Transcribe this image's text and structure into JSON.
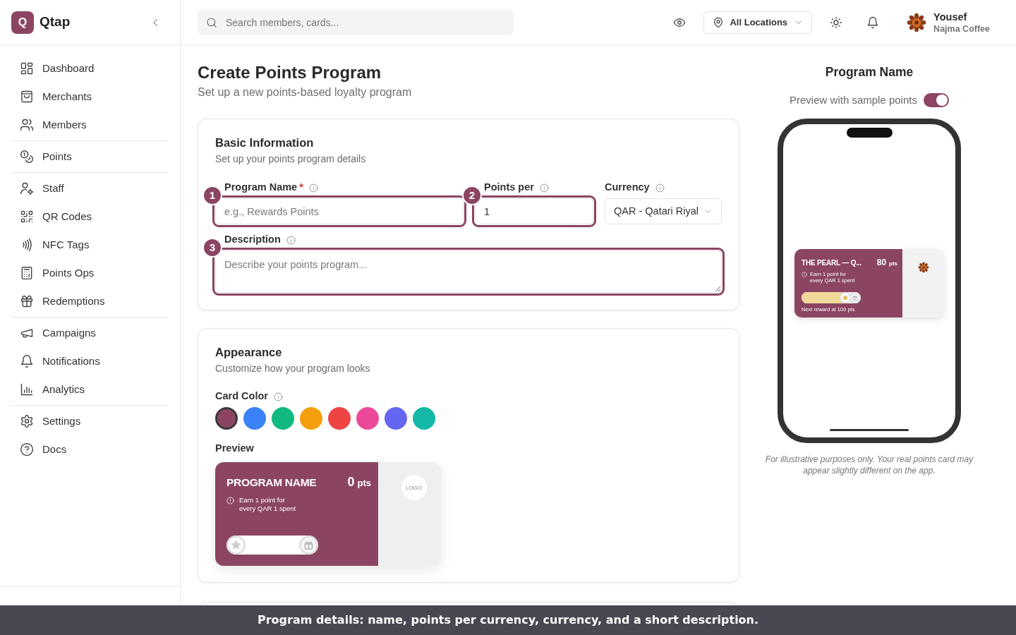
{
  "sidebar": {
    "brand": {
      "logo_letter": "Q",
      "name": "Qtap"
    },
    "nav_groups": [
      {
        "items": [
          {
            "label": "Dashboard",
            "selected": false
          },
          {
            "label": "Merchants",
            "selected": false
          },
          {
            "label": "Members",
            "selected": false
          }
        ]
      },
      {
        "items": [
          {
            "label": "Points",
            "selected": false
          }
        ]
      },
      {
        "items": [
          {
            "label": "Staff",
            "selected": false
          },
          {
            "label": "QR Codes",
            "selected": false
          },
          {
            "label": "NFC Tags",
            "selected": false
          },
          {
            "label": "Points Ops",
            "selected": false
          },
          {
            "label": "Redemptions",
            "selected": false
          }
        ]
      },
      {
        "items": [
          {
            "label": "Campaigns",
            "selected": false
          },
          {
            "label": "Notifications",
            "selected": false
          },
          {
            "label": "Analytics",
            "selected": false
          }
        ]
      },
      {
        "items": [
          {
            "label": "Settings",
            "selected": false
          },
          {
            "label": "Docs",
            "selected": false
          }
        ]
      }
    ]
  },
  "topbar": {
    "search": {
      "placeholder": "Search members, cards..."
    },
    "location": "All Locations",
    "user": {
      "name": "Yousef",
      "business": "Najma Coffee"
    }
  },
  "page": {
    "title": "Create Points Program",
    "subtitle": "Set up a new points-based loyalty program"
  },
  "basic_information": {
    "title": "Basic Information",
    "subtitle": "Set up your points program details",
    "fields": [
      {
        "kind": "text",
        "label": "Program Name",
        "required_mark": "*",
        "placeholder": "e.g., Rewards Points",
        "callout": "1"
      },
      {
        "kind": "text",
        "label": "Points per",
        "value": "1",
        "callout": "2"
      },
      {
        "kind": "select",
        "label": "Currency",
        "value": "QAR - Qatari Riyal"
      },
      {
        "kind": "textarea",
        "label": "Description",
        "placeholder": "Describe your points program...",
        "callout": "3"
      }
    ]
  },
  "appearance": {
    "title": "Appearance",
    "subtitle": "Customize how your program looks",
    "color_label": "Card Color",
    "colors": [
      {
        "color": "#8b4563",
        "selected": true
      },
      {
        "color": "#3b82f6",
        "selected": false
      },
      {
        "color": "#10b981",
        "selected": false
      },
      {
        "color": "#f59e0b",
        "selected": false
      },
      {
        "color": "#ef4444",
        "selected": false
      },
      {
        "color": "#ec4899",
        "selected": false
      },
      {
        "color": "#6366f1",
        "selected": false
      },
      {
        "color": "#14b8a6",
        "selected": false
      }
    ],
    "preview_label": "Preview",
    "preview_card": {
      "name": "PROGRAM NAME",
      "points": "0",
      "points_unit": "pts",
      "earn_text": "Earn 1 point for every QAR 1 spent",
      "logo_text": "LOGO",
      "level": 0
    }
  },
  "preview_panel": {
    "title": "Program Name",
    "toggle": {
      "label": "Preview with sample points",
      "on": true
    },
    "card": {
      "name": "THE PEARL — Q...",
      "points": "80",
      "points_unit": "pts",
      "earn_text": "Earn 1 point for every QAR 1 spent",
      "next_reward": "Next reward at 100 pts",
      "level": 0.8
    },
    "disclaimer": "For illustrative purposes only. Your real points card may appear slightly different on the app."
  },
  "caption": "Program details: name, points per currency, currency, and a short description."
}
